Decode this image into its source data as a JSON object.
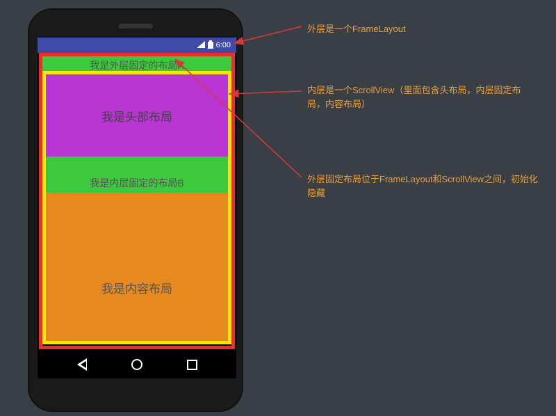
{
  "status": {
    "time": "6:00"
  },
  "layouts": {
    "fixed_a": "我是外层固定的布局A",
    "header": "我是头部布局",
    "fixed_b": "我是内层固定的布局B",
    "content": "我是内容布局"
  },
  "annotations": {
    "a1": "外层是一个FrameLayout",
    "a2": "内层是一个ScrollView（里面包含头布局，内层固定布局，内容布局）",
    "a3": "外层固定布局位于FrameLayout和ScrollView之间，初始化隐藏"
  },
  "colors": {
    "frame_border": "#f02d2d",
    "scroll_border": "#f5e50a",
    "green": "#3dc93d",
    "purple": "#b835d4",
    "orange": "#e68a1f",
    "statusbar": "#3e4aa8",
    "annotation_text": "#e6a040"
  }
}
